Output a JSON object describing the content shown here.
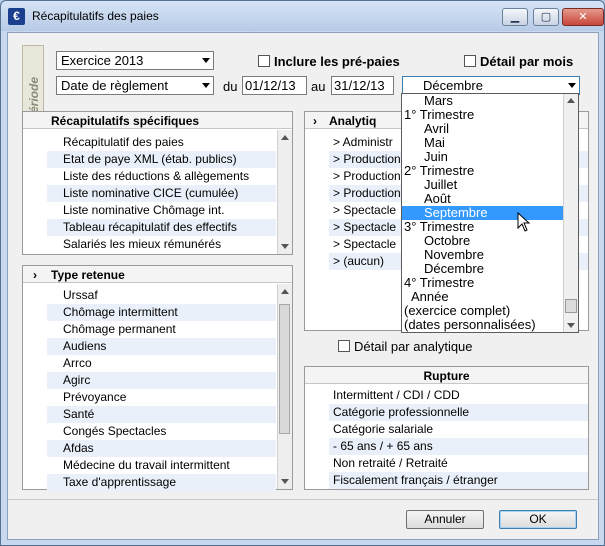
{
  "window": {
    "title": "Récapitulatifs des paies",
    "icon_letter": "€"
  },
  "periode": {
    "tab_label": "Période",
    "exercice_select": "Exercice 2013",
    "date_type_select": "Date de règlement",
    "du_label": "du",
    "au_label": "au",
    "date_from": "01/12/13",
    "date_to": "31/12/13",
    "month_select": "Décembre",
    "include_prepaies_label": "Inclure les pré-paies",
    "detail_par_mois_label": "Détail par mois"
  },
  "month_dropdown": [
    {
      "label": "Mars",
      "level": "month"
    },
    {
      "label": "1° Trimestre",
      "level": "quarter"
    },
    {
      "label": "Avril",
      "level": "month"
    },
    {
      "label": "Mai",
      "level": "month"
    },
    {
      "label": "Juin",
      "level": "month"
    },
    {
      "label": "2° Trimestre",
      "level": "quarter"
    },
    {
      "label": "Juillet",
      "level": "month"
    },
    {
      "label": "Août",
      "level": "month"
    },
    {
      "label": "Septembre",
      "level": "month",
      "selected": true
    },
    {
      "label": "3° Trimestre",
      "level": "quarter"
    },
    {
      "label": "Octobre",
      "level": "month"
    },
    {
      "label": "Novembre",
      "level": "month"
    },
    {
      "label": "Décembre",
      "level": "month"
    },
    {
      "label": "4° Trimestre",
      "level": "quarter"
    },
    {
      "label": "Année",
      "level": "year"
    },
    {
      "label": "(exercice complet)",
      "level": "other"
    },
    {
      "label": "(dates personnalisées)",
      "level": "other"
    }
  ],
  "recap_specifiques": {
    "title": "Récapitulatifs spécifiques",
    "items": [
      "Récapitulatif des paies",
      "Etat de paye XML (étab. publics)",
      "Liste des réductions & allègements",
      "Liste nominative CICE (cumulée)",
      "Liste nominative Chômage int.",
      "Tableau récapitulatif des effectifs",
      "Salariés les mieux rémunérés"
    ]
  },
  "type_retenue": {
    "title": "Type retenue",
    "items": [
      "Urssaf",
      "Chômage intermittent",
      "Chômage permanent",
      "Audiens",
      "Arrco",
      "Agirc",
      "Prévoyance",
      "Santé",
      "Congés Spectacles",
      "Afdas",
      "Médecine du travail intermittent",
      "Taxe d'apprentissage"
    ]
  },
  "analytique": {
    "title": "Analytiq",
    "items": [
      "> Administr",
      "> Production",
      "> Production",
      "> Production",
      "> Spectacle",
      "> Spectacle",
      "> Spectacle",
      "> (aucun)"
    ],
    "detail_label": "Détail par analytique"
  },
  "rupture": {
    "title": "Rupture",
    "items": [
      "Intermittent / CDI / CDD",
      "Catégorie professionnelle",
      "Catégorie salariale",
      "- 65 ans / + 65 ans",
      "Non retraité / Retraité",
      "Fiscalement français / étranger"
    ]
  },
  "buttons": {
    "cancel": "Annuler",
    "ok": "OK"
  },
  "colors": {
    "selection": "#3399ff",
    "alt_row": "#eaf0fa",
    "frame": "#c8d8ee"
  }
}
